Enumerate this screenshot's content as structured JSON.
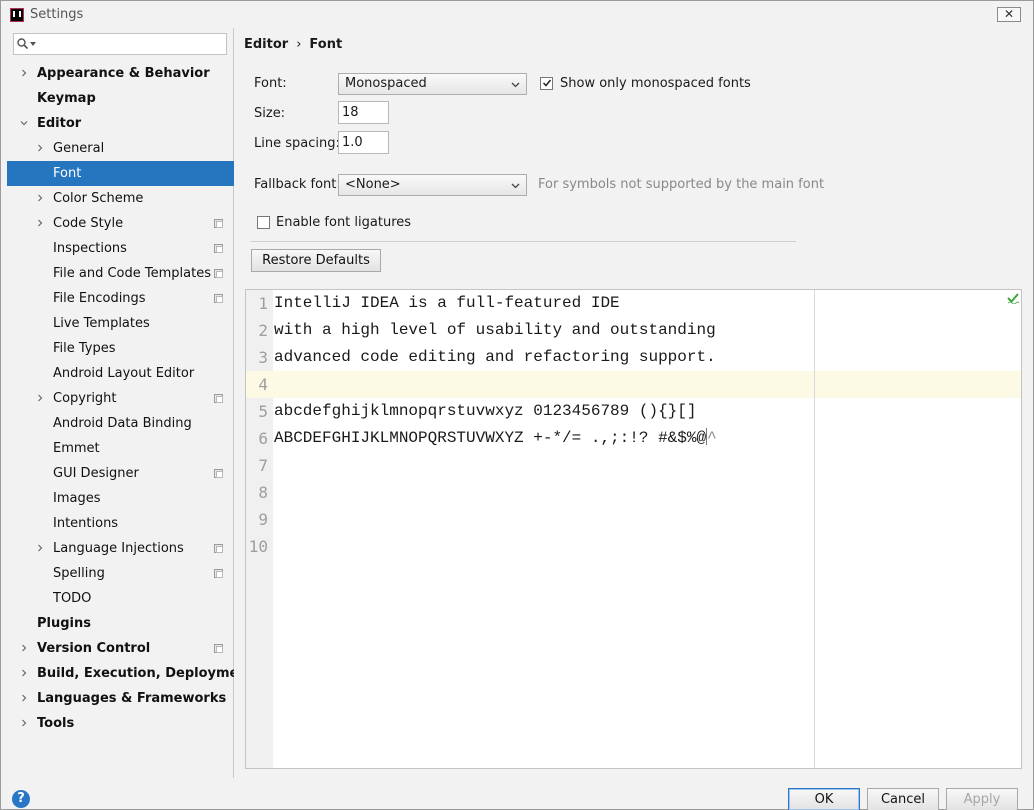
{
  "window": {
    "title": "Settings",
    "close_glyph": "✕"
  },
  "search": {
    "placeholder": "",
    "value": ""
  },
  "tree": [
    {
      "label": "Appearance & Behavior",
      "expand": "right",
      "level": 0,
      "bold": true,
      "copy": false
    },
    {
      "label": "Keymap",
      "expand": "",
      "level": 0,
      "bold": true,
      "copy": false
    },
    {
      "label": "Editor",
      "expand": "down",
      "level": 0,
      "bold": true,
      "copy": false
    },
    {
      "label": "General",
      "expand": "right",
      "level": 1,
      "bold": false,
      "copy": false
    },
    {
      "label": "Font",
      "expand": "",
      "level": 1,
      "bold": false,
      "copy": false,
      "selected": true
    },
    {
      "label": "Color Scheme",
      "expand": "right",
      "level": 1,
      "bold": false,
      "copy": false
    },
    {
      "label": "Code Style",
      "expand": "right",
      "level": 1,
      "bold": false,
      "copy": true
    },
    {
      "label": "Inspections",
      "expand": "",
      "level": 1,
      "bold": false,
      "copy": true
    },
    {
      "label": "File and Code Templates",
      "expand": "",
      "level": 1,
      "bold": false,
      "copy": true
    },
    {
      "label": "File Encodings",
      "expand": "",
      "level": 1,
      "bold": false,
      "copy": true
    },
    {
      "label": "Live Templates",
      "expand": "",
      "level": 1,
      "bold": false,
      "copy": false
    },
    {
      "label": "File Types",
      "expand": "",
      "level": 1,
      "bold": false,
      "copy": false
    },
    {
      "label": "Android Layout Editor",
      "expand": "",
      "level": 1,
      "bold": false,
      "copy": false
    },
    {
      "label": "Copyright",
      "expand": "right",
      "level": 1,
      "bold": false,
      "copy": true
    },
    {
      "label": "Android Data Binding",
      "expand": "",
      "level": 1,
      "bold": false,
      "copy": false
    },
    {
      "label": "Emmet",
      "expand": "",
      "level": 1,
      "bold": false,
      "copy": false
    },
    {
      "label": "GUI Designer",
      "expand": "",
      "level": 1,
      "bold": false,
      "copy": true
    },
    {
      "label": "Images",
      "expand": "",
      "level": 1,
      "bold": false,
      "copy": false
    },
    {
      "label": "Intentions",
      "expand": "",
      "level": 1,
      "bold": false,
      "copy": false
    },
    {
      "label": "Language Injections",
      "expand": "right",
      "level": 1,
      "bold": false,
      "copy": true
    },
    {
      "label": "Spelling",
      "expand": "",
      "level": 1,
      "bold": false,
      "copy": true
    },
    {
      "label": "TODO",
      "expand": "",
      "level": 1,
      "bold": false,
      "copy": false
    },
    {
      "label": "Plugins",
      "expand": "",
      "level": 0,
      "bold": true,
      "copy": false
    },
    {
      "label": "Version Control",
      "expand": "right",
      "level": 0,
      "bold": true,
      "copy": true
    },
    {
      "label": "Build, Execution, Deployment",
      "expand": "right",
      "level": 0,
      "bold": true,
      "copy": false
    },
    {
      "label": "Languages & Frameworks",
      "expand": "right",
      "level": 0,
      "bold": true,
      "copy": false
    },
    {
      "label": "Tools",
      "expand": "right",
      "level": 0,
      "bold": true,
      "copy": false
    }
  ],
  "breadcrumb": {
    "parent": "Editor",
    "separator": "›",
    "current": "Font"
  },
  "form": {
    "font_label": "Font:",
    "font_value": "Monospaced",
    "show_mono_label": "Show only monospaced fonts",
    "show_mono_checked": true,
    "size_label": "Size:",
    "size_value": "18",
    "line_spacing_label": "Line spacing:",
    "line_spacing_value": "1.0",
    "fallback_label": "Fallback font:",
    "fallback_value": "<None>",
    "fallback_hint": "For symbols not supported by the main font",
    "ligatures_label": "Enable font ligatures",
    "ligatures_checked": false,
    "restore_label": "Restore Defaults"
  },
  "preview": {
    "lines": [
      {
        "num": "1",
        "text": "IntelliJ IDEA is a full-featured IDE"
      },
      {
        "num": "2",
        "text": "with a high level of usability and outstanding"
      },
      {
        "num": "3",
        "text": "advanced code editing and refactoring support."
      },
      {
        "num": "4",
        "text": ""
      },
      {
        "num": "5",
        "text": "abcdefghijklmnopqrstuvwxyz 0123456789 (){}[]"
      },
      {
        "num": "6",
        "text": "ABCDEFGHIJKLMNOPQRSTUVWXYZ +-*/= .,;:!? #&$%@",
        "caret_after": "^"
      },
      {
        "num": "7",
        "text": ""
      },
      {
        "num": "8",
        "text": ""
      },
      {
        "num": "9",
        "text": ""
      },
      {
        "num": "10",
        "text": ""
      }
    ]
  },
  "footer": {
    "help_glyph": "?",
    "ok_label": "OK",
    "cancel_label": "Cancel",
    "apply_label": "Apply"
  },
  "colors": {
    "accent": "#2675bf",
    "current_line": "#fcfae5"
  }
}
